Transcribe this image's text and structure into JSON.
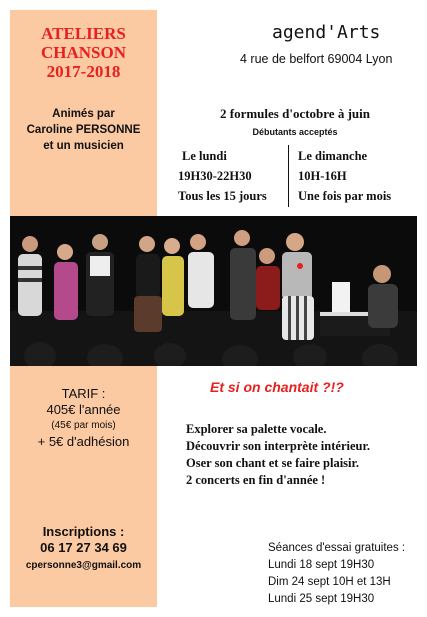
{
  "title": {
    "line1": "ATELIERS",
    "line2": "CHANSON",
    "line3": "2017-2018"
  },
  "hosts": {
    "line1": "Animés par",
    "line2": "Caroline PERSONNE",
    "line3": "et un musicien"
  },
  "venue": {
    "name": "agend'Arts",
    "address": "4 rue de belfort  69004 Lyon"
  },
  "schedule": {
    "headline": "2 formules d'octobre à juin",
    "beginners": "Débutants acceptés",
    "monday": {
      "day": "Le lundi",
      "time": "19H30-22H30",
      "freq": "Tous les 15 jours"
    },
    "sunday": {
      "day": "Le dimanche",
      "time": "10H-16H",
      "freq": "Une fois par mois"
    }
  },
  "tarif": {
    "label": "TARIF :",
    "year": "405€ l'année",
    "month": "(45€ par mois)",
    "fee": "+ 5€ d'adhésion"
  },
  "contact": {
    "label": "Inscriptions :",
    "phone": "06 17 27 34 69",
    "email": "cpersonne3@gmail.com"
  },
  "tagline": "Et si on chantait ?!?",
  "benefits": [
    "Explorer sa palette vocale.",
    "Découvrir son interprète intérieur.",
    "Oser son chant et se faire plaisir.",
    "2 concerts en fin d'année !"
  ],
  "trial": {
    "label": "Séances d'essai gratuites :",
    "dates": [
      "Lundi 18 sept 19H30",
      "Dim 24 sept 10H et 13H",
      "Lundi 25 sept 19H30"
    ]
  },
  "colors": {
    "accent": "#e8201f",
    "panel": "#fbc9a2"
  }
}
